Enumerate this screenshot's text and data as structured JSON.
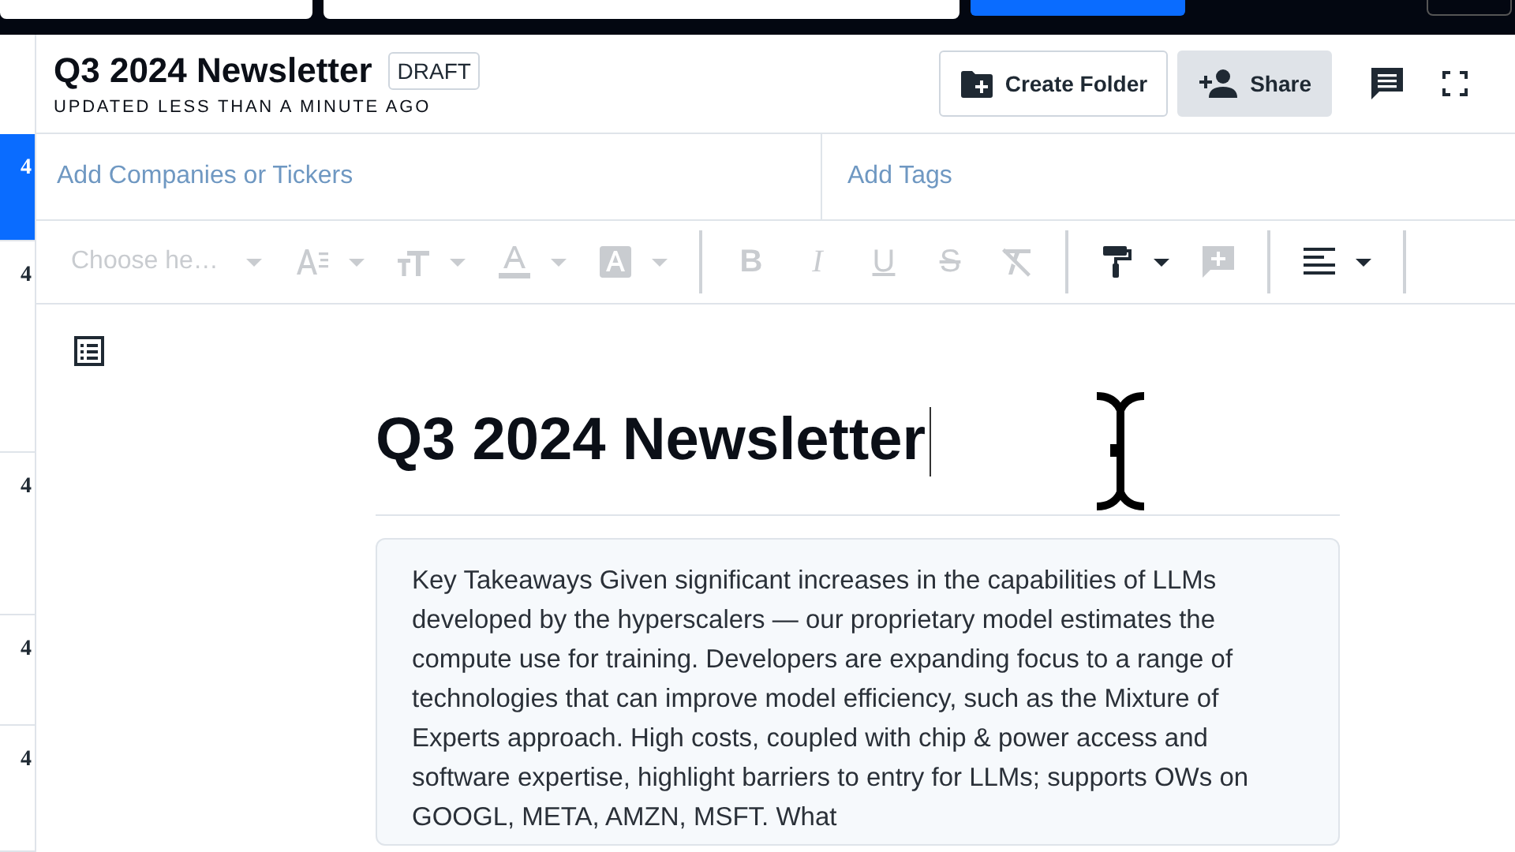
{
  "rail": {
    "items": [
      {
        "label": "4",
        "selected": true
      },
      {
        "label": "4",
        "selected": false
      },
      {
        "label": "4",
        "selected": false
      },
      {
        "label": "4",
        "selected": false
      },
      {
        "label": "4",
        "selected": false
      }
    ]
  },
  "header": {
    "title": "Q3 2024 Newsletter",
    "status": "DRAFT",
    "updated": "UPDATED LESS THAN A MINUTE AGO",
    "buttons": [
      {
        "kind": "create-folder",
        "label": "Create Folder"
      },
      {
        "kind": "share",
        "label": "Share"
      }
    ]
  },
  "fields": [
    {
      "placeholder": "Add Companies or Tickers"
    },
    {
      "placeholder": "Add Tags"
    }
  ],
  "toolbar": [
    {
      "kind": "heading-select",
      "placeholder": "Choose he…",
      "disabled": true
    },
    {
      "kind": "line-height",
      "disabled": true,
      "menu": true
    },
    {
      "kind": "text-size",
      "disabled": true,
      "menu": true
    },
    {
      "kind": "font-color",
      "disabled": true,
      "menu": true
    },
    {
      "kind": "highlight",
      "disabled": true,
      "menu": true
    },
    {
      "kind": "separator"
    },
    {
      "kind": "bold",
      "glyph": "B",
      "disabled": true
    },
    {
      "kind": "italic",
      "glyph": "I",
      "disabled": true
    },
    {
      "kind": "underline",
      "glyph": "U",
      "disabled": true
    },
    {
      "kind": "strike",
      "glyph": "S",
      "disabled": true
    },
    {
      "kind": "clear-format",
      "disabled": true
    },
    {
      "kind": "separator"
    },
    {
      "kind": "paint-format",
      "disabled": false,
      "menu": true
    },
    {
      "kind": "add-comment",
      "disabled": true
    },
    {
      "kind": "separator"
    },
    {
      "kind": "align-left",
      "disabled": false,
      "menu": true
    },
    {
      "kind": "separator"
    }
  ],
  "document": {
    "title": "Q3 2024 Newsletter",
    "editing": true,
    "body": "Key Takeaways Given significant increases in the capabilities of LLMs developed by the hyperscalers — our proprietary model estimates the compute use for training. Developers are expanding focus to a range of technologies that can improve model efficiency, such as the Mixture of Experts approach. High costs, coupled with chip & power access and software expertise, highlight barriers to entry for LLMs; supports OWs on GOOGL, META, AMZN, MSFT. What"
  }
}
